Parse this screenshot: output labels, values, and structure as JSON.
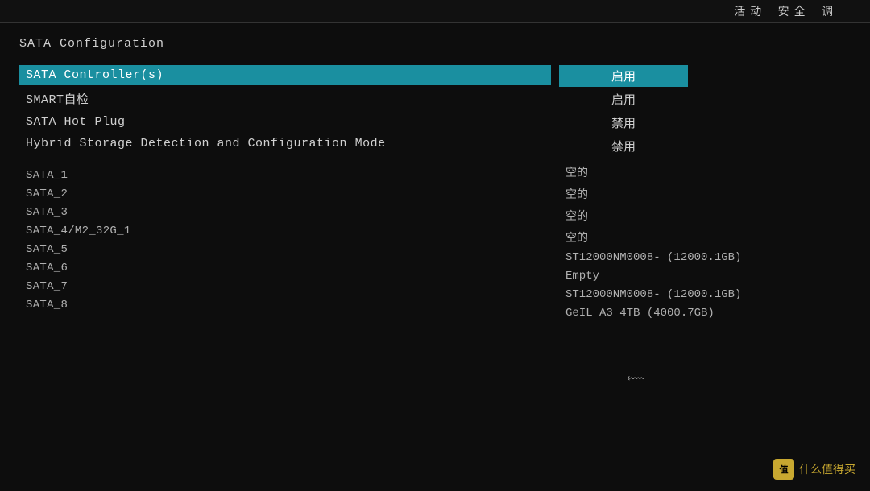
{
  "topbar": {
    "text": "活动        安全        调"
  },
  "bios": {
    "section_title": "SATA  Configuration",
    "settings": [
      {
        "label": "SATA  Controller(s)",
        "selected": true
      },
      {
        "label": "SMART自检",
        "selected": false
      },
      {
        "label": "SATA  Hot  Plug",
        "selected": false
      },
      {
        "label": "Hybrid  Storage  Detection  and  Configuration  Mode",
        "selected": false
      }
    ],
    "sata_ports": [
      {
        "label": "SATA_1"
      },
      {
        "label": "SATA_2"
      },
      {
        "label": "SATA_3"
      },
      {
        "label": "SATA_4/M2_32G_1"
      },
      {
        "label": "SATA_5"
      },
      {
        "label": "SATA_6"
      },
      {
        "label": "SATA_7"
      },
      {
        "label": "SATA_8"
      }
    ],
    "values": {
      "controller_options": [
        {
          "label": "启用",
          "selected": true
        },
        {
          "label": "启用",
          "selected": false
        },
        {
          "label": "禁用",
          "selected": false
        },
        {
          "label": "禁用",
          "selected": false
        }
      ],
      "sata_devices": [
        {
          "value": "空的"
        },
        {
          "value": "空的"
        },
        {
          "value": "空的"
        },
        {
          "value": "空的"
        },
        {
          "value": "ST12000NM0008-   (12000.1GB)"
        },
        {
          "value": "Empty"
        },
        {
          "value": "ST12000NM0008-   (12000.1GB)"
        },
        {
          "value": "GeIL  A3  4TB     (4000.7GB)"
        }
      ]
    }
  },
  "watermark": {
    "icon_text": "值",
    "text": "什么值得买"
  }
}
